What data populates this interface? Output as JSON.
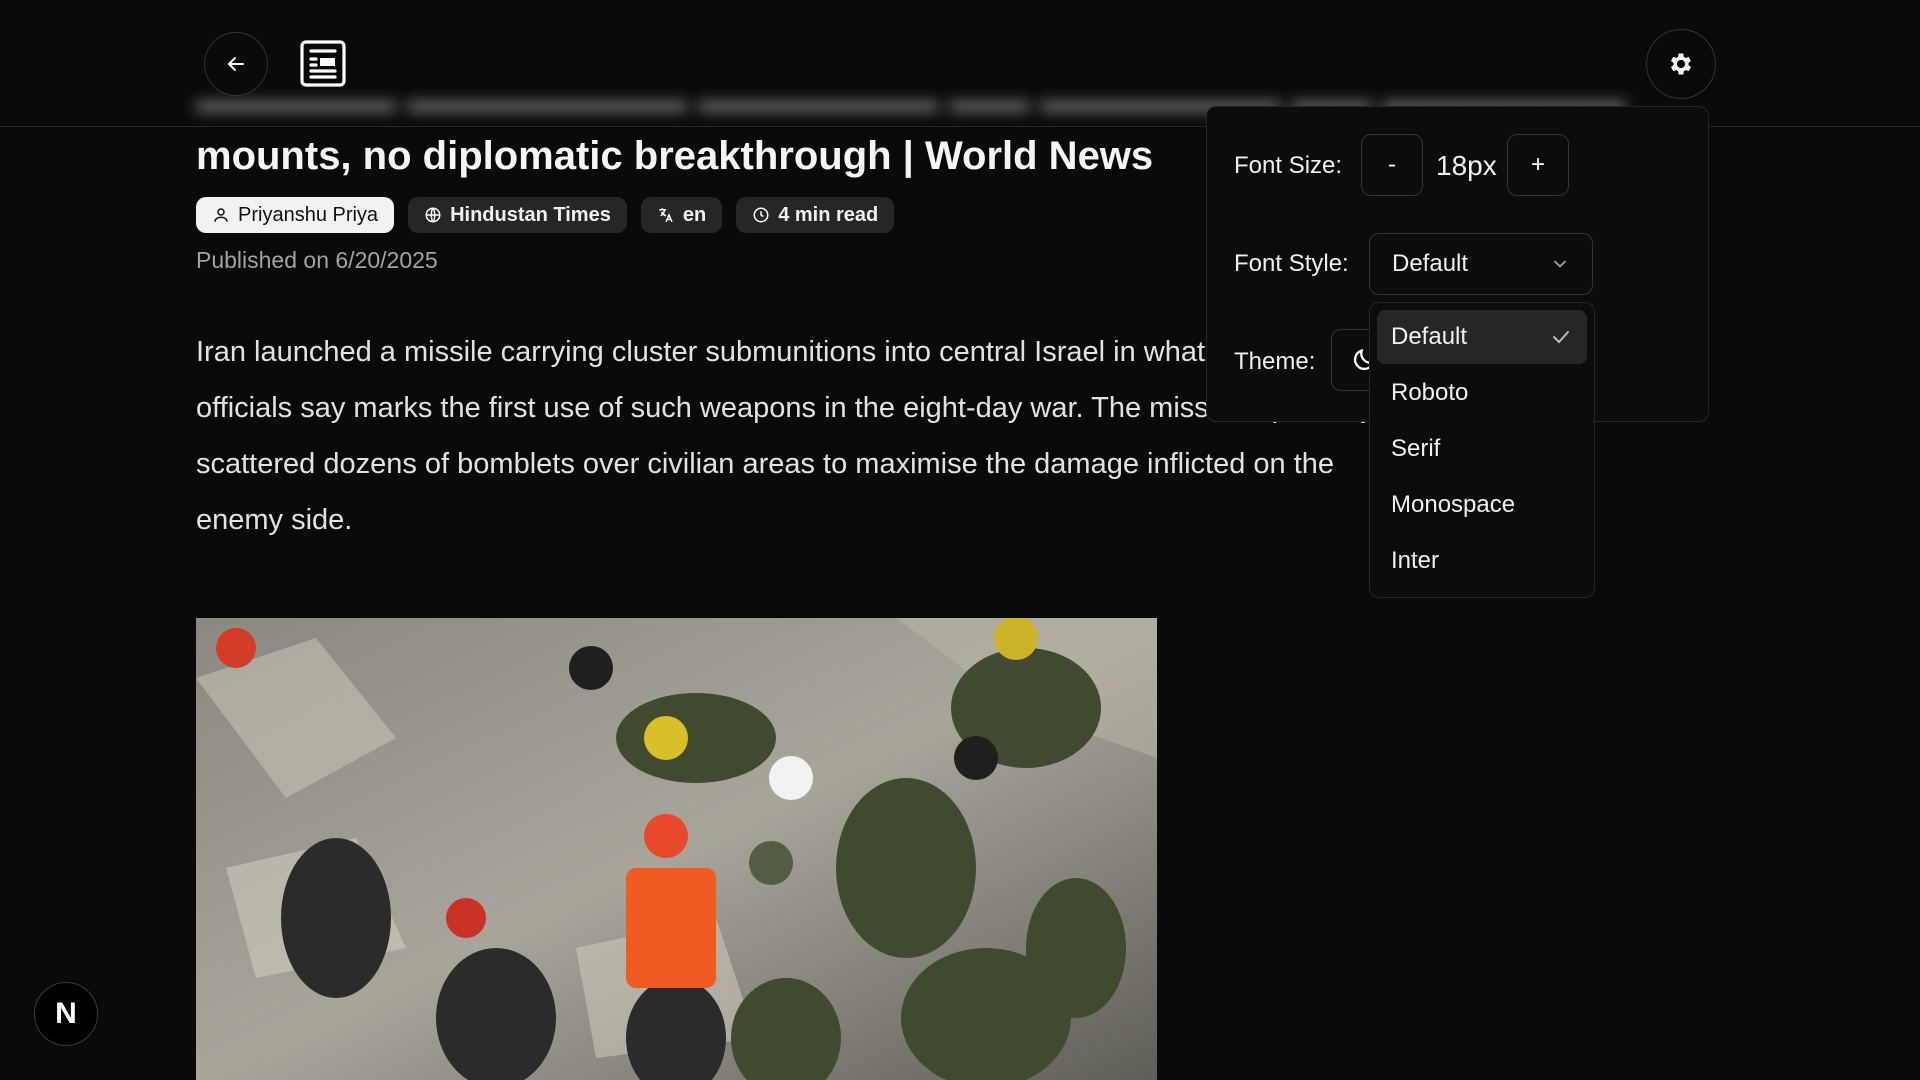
{
  "header": {
    "back_icon": "arrow-left-icon",
    "reader_icon": "reader-mode-icon",
    "settings_icon": "gear-icon"
  },
  "article": {
    "title_visible": "mounts, no diplomatic breakthrough | World News",
    "author": "Priyanshu Priya",
    "source": "Hindustan Times",
    "language": "en",
    "read_time": "4 min read",
    "published": "Published on 6/20/2025",
    "body": "Iran launched a missile carrying cluster submunitions into central Israel in what Israeli officials say marks the first use of such weapons in the eight-day war. The missile reportedly scattered dozens of bomblets over civilian areas to maximise the damage inflicted on the enemy side."
  },
  "settings": {
    "font_size_label": "Font Size:",
    "decrease_label": "-",
    "font_size_value": "18px",
    "increase_label": "+",
    "font_style_label": "Font Style:",
    "font_style_value": "Default",
    "theme_label": "Theme:",
    "theme_icon": "moon-icon"
  },
  "font_options": [
    "Default",
    "Roboto",
    "Serif",
    "Monospace",
    "Inter"
  ],
  "selected_font": "Default",
  "badge": {
    "letter": "N"
  }
}
